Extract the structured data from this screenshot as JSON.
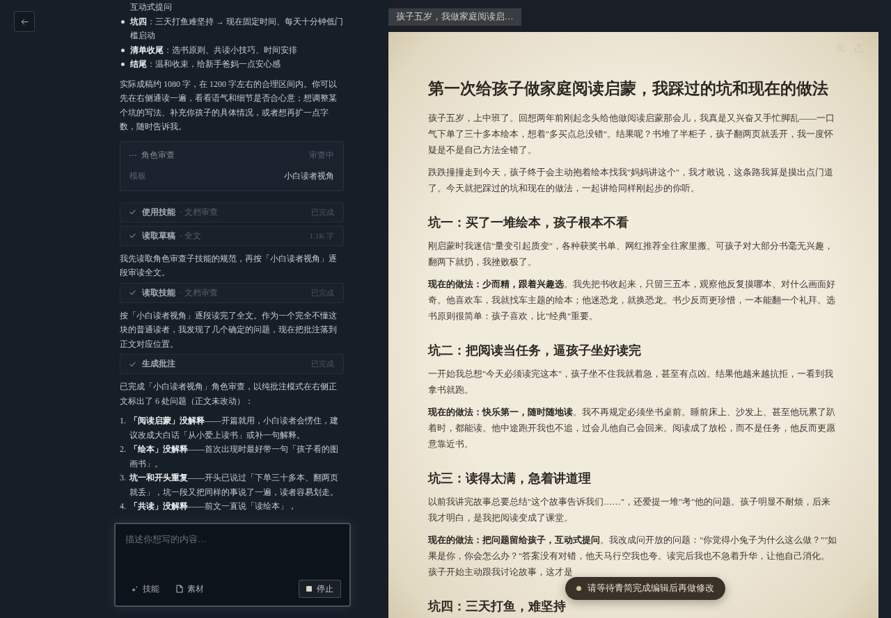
{
  "chat": {
    "blocks": [
      {
        "kind": "bullets",
        "items": [
          {
            "marker": false,
            "text": "互动式提问"
          },
          {
            "marker": true,
            "text": "**坑四**：三天打鱼难坚持 → 现在固定时间、每天十分钟低门槛启动"
          },
          {
            "marker": true,
            "text": "**清单收尾**：选书原则、共读小技巧、时间安排"
          },
          {
            "marker": true,
            "text": "**结尾**：温和收束，给新手爸妈一点安心感"
          }
        ]
      },
      {
        "kind": "paragraph",
        "text": "实际成稿约 1080 字，在 1200 字左右的合理区间内。你可以先在右侧通读一遍，看看语气和细节是否合心意；想调整某个坑的写法、补充你孩子的具体情况，或者想再扩一点字数，随时告诉我。"
      },
      {
        "kind": "status_card",
        "running": true,
        "title": "角色审查",
        "status": "审查中",
        "field_label": "模板",
        "field_value": "小白读者视角"
      },
      {
        "kind": "tool",
        "done": true,
        "name": "使用技能",
        "detail": "· 文档审查",
        "status": "已完成"
      },
      {
        "kind": "tool",
        "done": true,
        "name": "读取草稿",
        "detail": "· 全文",
        "status": "1.1K 字"
      },
      {
        "kind": "paragraph",
        "text": "我先读取角色审查子技能的规范，再按「小白读者视角」逐段审读全文。"
      },
      {
        "kind": "tool",
        "done": true,
        "name": "读取技能",
        "detail": "· 文档审查",
        "status": "已完成"
      },
      {
        "kind": "paragraph",
        "text": "按「小白读者视角」逐段读完了全文。作为一个完全不懂这块的普通读者，我发现了几个确定的问题，现在把批注落到正文对应位置。"
      },
      {
        "kind": "tool",
        "done": true,
        "name": "生成批注",
        "status": "已完成"
      },
      {
        "kind": "paragraph",
        "text": "已完成「小白读者视角」角色审查，以纯批注模式在右侧正文标出了 6 处问题（正文未改动）："
      },
      {
        "kind": "numbered",
        "items": [
          {
            "number": "1.",
            "text": "**「阅读启蒙」没解释**——开篇就用，小白读者会愣住，建议改成大白话「从小爱上读书」或补一句解释。"
          },
          {
            "number": "2.",
            "text": "**「绘本」没解释**——首次出现时最好带一句「孩子看的图画书」。"
          },
          {
            "number": "3.",
            "text": "**坑一和开头重复**——开头已说过「下单三十多本、翻两页就丢」，坑一段又把同样的事说了一遍，读者容易划走。"
          },
          {
            "number": "4.",
            "text": "**「共读」没解释**——前文一直说「读绘本」，"
          }
        ]
      }
    ]
  },
  "composer": {
    "placeholder": "描述你想写的内容…",
    "tools": [
      {
        "kind": "skill",
        "label": "技能"
      },
      {
        "kind": "material",
        "label": "素材"
      }
    ],
    "stop_button": "停止"
  },
  "document": {
    "tab": "孩子五岁，我做家庭阅读启…",
    "title": "第一次给孩子做家庭阅读启蒙，我踩过的坑和现在的做法",
    "blocks": [
      {
        "kind": "paragraph",
        "text": "孩子五岁，上中班了。回想两年前刚起念头给他做阅读启蒙那会儿，我真是又兴奋又手忙脚乱——一口气下单了三十多本绘本，想着\"多买点总没错\"。结果呢？书堆了半柜子，孩子翻两页就丢开，我一度怀疑是不是自己方法全错了。"
      },
      {
        "kind": "paragraph",
        "text": "跌跌撞撞走到今天，孩子终于会主动抱着绘本找我\"妈妈讲这个\"，我才敢说，这条路我算是摸出点门道了。今天就把踩过的坑和现在的做法，一起讲给同样刚起步的你听。"
      },
      {
        "kind": "heading",
        "text": "坑一：买了一堆绘本，孩子根本不看"
      },
      {
        "kind": "paragraph",
        "text": "刚启蒙时我迷信\"量变引起质变\"，各种获奖书单、网红推荐全往家里搬。可孩子对大部分书毫无兴趣，翻两下就扔，我挫败极了。"
      },
      {
        "kind": "paragraph",
        "text": "**现在的做法：少而精，跟着兴趣选**。我先把书收起来，只留三五本，观察他反复摸哪本、对什么画面好奇。他喜欢车，我就找车主题的绘本；他迷恐龙，就换恐龙。书少反而更珍惜，一本能翻一个礼拜。选书原则很简单：孩子喜欢，比\"经典\"重要。"
      },
      {
        "kind": "heading",
        "text": "坑二：把阅读当任务，逼孩子坐好读完"
      },
      {
        "kind": "paragraph",
        "text": "一开始我总想\"今天必须读完这本\"，孩子坐不住我就着急，甚至有点凶。结果他越来越抗拒，一看到我拿书就跑。"
      },
      {
        "kind": "paragraph",
        "text": "**现在的做法：快乐第一，随时随地读**。我不再规定必须坐书桌前。睡前床上、沙发上、甚至他玩累了趴着时，都能读。他中途跑开我也不追，过会儿他自己会回来。阅读成了放松，而不是任务，他反而更愿意靠近书。"
      },
      {
        "kind": "heading",
        "text": "坑三：读得太满，急着讲道理"
      },
      {
        "kind": "paragraph",
        "text": "以前我讲完故事总要总结\"这个故事告诉我们……\"，还爱提一堆\"考\"他的问题。孩子明显不耐烦，后来我才明白，是我把阅读变成了课堂。"
      },
      {
        "kind": "paragraph",
        "text": "**现在的做法：把问题留给孩子，互动式提问**。我改成问开放的问题：\"你觉得小兔子为什么这么做？\"\"如果是你，你会怎么办？\"答案没有对错，他天马行空我也夸。读完后我也不急着升华，让他自己消化。孩子开始主动跟我讨论故事，这才是"
      },
      {
        "kind": "heading",
        "text": "坑四：三天打鱼，难坚持"
      }
    ]
  },
  "toast": {
    "text": "请等待青简完成编辑后再做修改"
  }
}
